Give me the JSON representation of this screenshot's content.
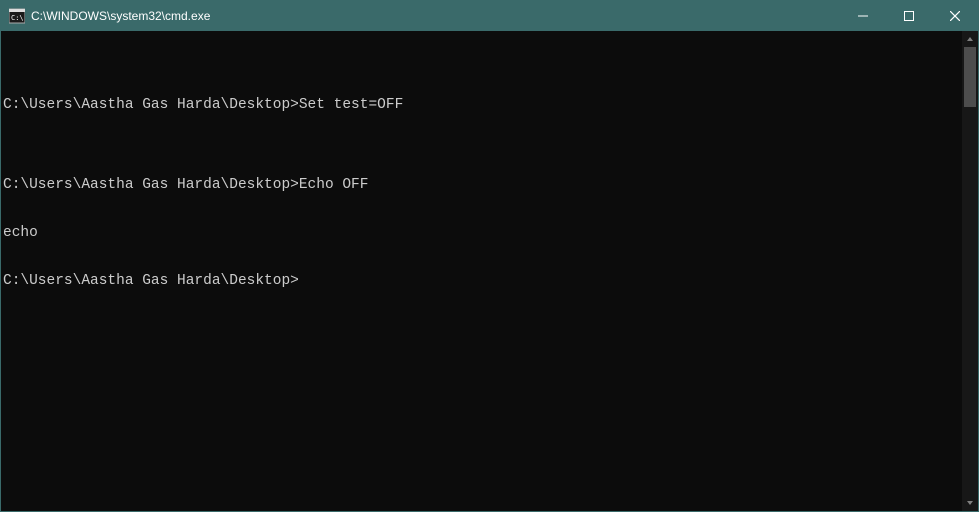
{
  "window": {
    "title": "C:\\WINDOWS\\system32\\cmd.exe"
  },
  "terminal": {
    "lines": [
      "",
      "C:\\Users\\Aastha Gas Harda\\Desktop>Set test=OFF",
      "",
      "C:\\Users\\Aastha Gas Harda\\Desktop>Echo OFF",
      "echo",
      "C:\\Users\\Aastha Gas Harda\\Desktop>"
    ]
  }
}
